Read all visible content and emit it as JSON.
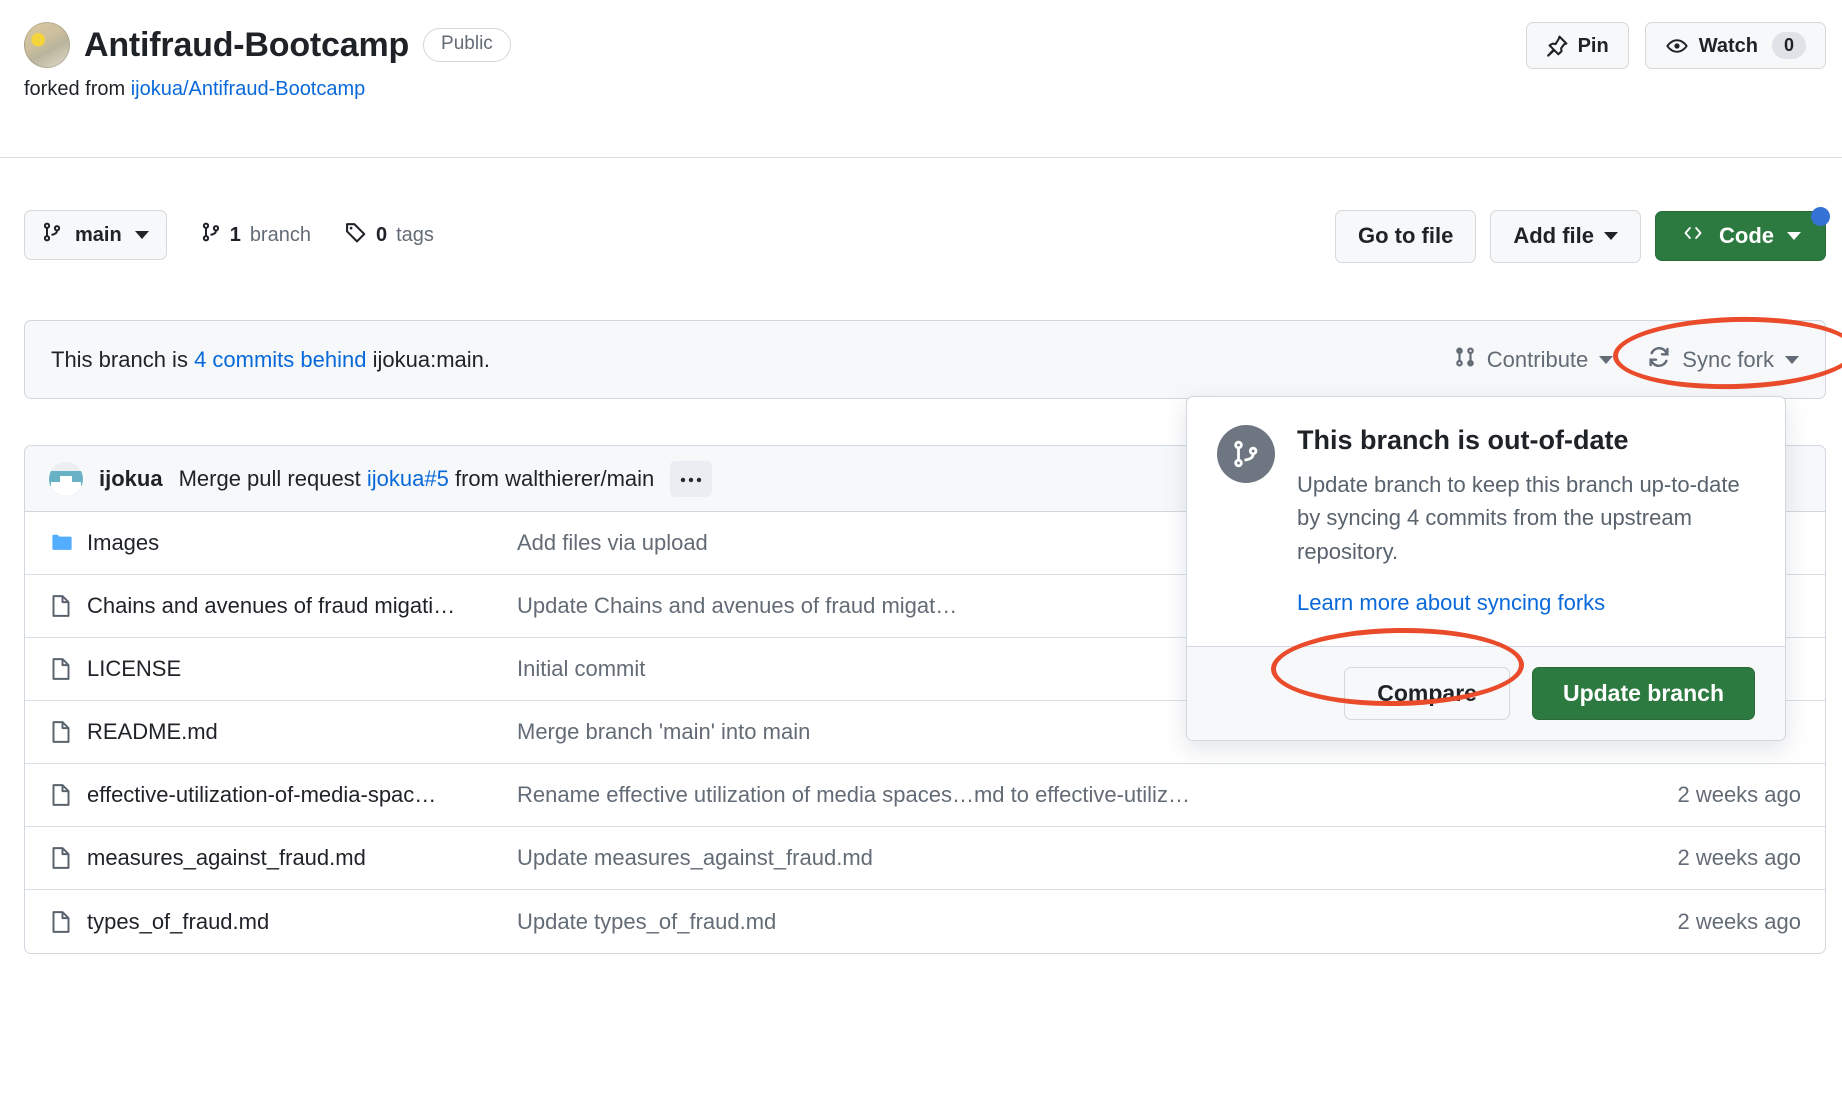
{
  "header": {
    "repo_name": "Antifraud-Bootcamp",
    "visibility": "Public",
    "forked_prefix": "forked from ",
    "forked_source": "ijokua/Antifraud-Bootcamp",
    "pin_label": "Pin",
    "watch_label": "Watch",
    "watch_count": "0"
  },
  "toolbar": {
    "branch": "main",
    "branch_count": "1",
    "branch_word": "branch",
    "tag_count": "0",
    "tag_word": "tags",
    "go_to_file": "Go to file",
    "add_file": "Add file",
    "code": "Code"
  },
  "branch_status": {
    "prefix": "This branch is ",
    "link": "4 commits behind",
    "suffix": " ijokua:main.",
    "contribute": "Contribute",
    "sync_fork": "Sync fork"
  },
  "commit_bar": {
    "author": "ijokua",
    "message_prefix": "Merge pull request ",
    "pr_link": "ijokua#5",
    "message_suffix": " from walthierer/main",
    "more": "•••"
  },
  "files": [
    {
      "icon": "folder-icon",
      "name": "Images",
      "commit": "Add files via upload",
      "time": ""
    },
    {
      "icon": "file-icon",
      "name": "Chains and avenues of fraud migati…",
      "commit": "Update Chains and avenues of fraud migat…",
      "time": ""
    },
    {
      "icon": "file-icon",
      "name": "LICENSE",
      "commit": "Initial commit",
      "time": ""
    },
    {
      "icon": "file-icon",
      "name": "README.md",
      "commit": "Merge branch 'main' into main",
      "time": ""
    },
    {
      "icon": "file-icon",
      "name": "effective-utilization-of-media-spac…",
      "commit": "Rename effective utilization of media spaces…md to effective-utiliz…",
      "time": "2 weeks ago"
    },
    {
      "icon": "file-icon",
      "name": "measures_against_fraud.md",
      "commit": "Update measures_against_fraud.md",
      "time": "2 weeks ago"
    },
    {
      "icon": "file-icon",
      "name": "types_of_fraud.md",
      "commit": "Update types_of_fraud.md",
      "time": "2 weeks ago"
    }
  ],
  "sync_popup": {
    "heading": "This branch is out-of-date",
    "body": "Update branch to keep this branch up-to-date by syncing 4 commits from the upstream repository.",
    "learn_more": "Learn more about syncing forks",
    "compare": "Compare",
    "update_branch": "Update branch"
  },
  "colors": {
    "brand_green": "#2c7a3f",
    "link_blue": "#0969da",
    "annotation_red": "#ea4b2a",
    "folder_blue": "#54aeff"
  }
}
